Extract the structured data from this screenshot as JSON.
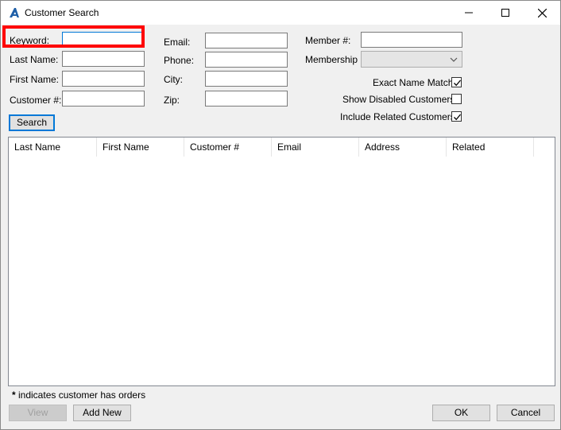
{
  "window": {
    "title": "Customer Search"
  },
  "form": {
    "keyword_label": "Keyword:",
    "keyword_value": "",
    "lastname_label": "Last Name:",
    "lastname_value": "",
    "firstname_label": "First Name:",
    "firstname_value": "",
    "customer_no_label": "Customer #:",
    "customer_no_value": "",
    "email_label": "Email:",
    "email_value": "",
    "phone_label": "Phone:",
    "phone_value": "",
    "city_label": "City:",
    "city_value": "",
    "zip_label": "Zip:",
    "zip_value": "",
    "member_no_label": "Member #:",
    "member_no_value": "",
    "membership_label": "Membership",
    "membership_value": "",
    "exact_name_match_label": "Exact Name Match",
    "exact_name_match_checked": true,
    "show_disabled_label": "Show Disabled Customers",
    "show_disabled_checked": false,
    "include_related_label": "Include Related Customers",
    "include_related_checked": true,
    "search_button": "Search"
  },
  "results": {
    "columns": [
      "Last Name",
      "First Name",
      "Customer #",
      "Email",
      "Address",
      "Related"
    ],
    "rows": []
  },
  "footer": {
    "note_mark": "*",
    "note_text": " indicates customer has orders",
    "view_button": "View",
    "add_new_button": "Add New",
    "ok_button": "OK",
    "cancel_button": "Cancel"
  },
  "colors": {
    "highlight": "#ff0000",
    "accent": "#0078d7",
    "window_bg": "#f0f0f0"
  }
}
